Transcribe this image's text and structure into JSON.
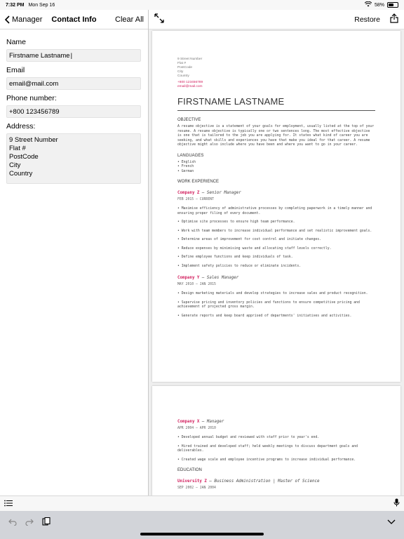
{
  "status": {
    "time": "7:32 PM",
    "date": "Mon Sep 16",
    "battery": "58%",
    "battery_level": 0.58
  },
  "nav": {
    "back_label": "Manager",
    "title": "Contact Info",
    "clear_label": "Clear All"
  },
  "form": {
    "name_label": "Name",
    "name_value": "Firstname Lastname",
    "email_label": "Email",
    "email_value": "email@mail.com",
    "phone_label": "Phone number:",
    "phone_value": "+800 123456789",
    "address_label": "Address:",
    "address_value": "9 Street Number\nFlat #\nPostCode\nCity\nCountry"
  },
  "toolbar": {
    "restore_label": "Restore"
  },
  "resume": {
    "address_lines": [
      "9 Street Number",
      "Flat #",
      "PostCode",
      "City",
      "Country"
    ],
    "phone": "+800 123456789",
    "email": "email@mail.com",
    "name": "FIRSTNAME LASTNAME",
    "objective_heading": "OBJECTIVE",
    "objective_text": "A resume objective is a statement of your goals for employment, usually listed at the top of your resume. A resume objective is typically one or two sentences long. The most effective objective is one that is tailored to the job you are applying for. It states what kind of career you are seeking, and what skills and experiences you have that make you ideal for that career. A resume objective might also include where you have been and where you want to go in your career.",
    "languages_heading": "LANGUAGES",
    "languages": [
      "• English",
      "• French",
      "• German"
    ],
    "work_heading": "WORK EXPERIENCE",
    "jobs_page1": [
      {
        "company": "Company Z",
        "role": " – Senior Manager",
        "dates": "FEB 2015 – CURRENT",
        "tasks": [
          "• Maximise efficiency of administrative processes by completing paperwork in a timely manner and ensuring proper filing of every document.",
          "• Optimise site processes to ensure high team performance.",
          "• Work with team members to increase individual performance and set realistic improvement goals.",
          "• Determine areas of improvement for cost control and initiate changes.",
          "• Reduce expenses by minimising waste and allocating staff levels correctly.",
          "• Define employee functions and keep individuals of task.",
          "• Implement safety policies to reduce or eliminate incidents."
        ]
      },
      {
        "company": "Company Y",
        "role": " – Sales Manager",
        "dates": "MAY 2010 – JAN 2015",
        "tasks": [
          "• Design marketing materials and develop strategies to increase sales and product recognition.",
          "• Supervise pricing and inventory policies and functions to ensure competitive pricing and achievement of projected gross margin.",
          "• Generate reports and keep board apprised of departments' initiatives and activities."
        ]
      }
    ],
    "job_page2": {
      "company": "Company X",
      "role": " – Manager",
      "dates": "APR 2004 – APR 2010",
      "tasks": [
        "• Developed annual budget and reviewed with staff prior to year's end.",
        "• Hired trained and developed staff; held weekly meetings to discuss department goals and deliverables.",
        "• Created wage scale and employee incentive programs to increase individual performance."
      ]
    },
    "education_heading": "EDUCATION",
    "education": {
      "school": "University Z",
      "degree": " – Business Administration | Master of Science",
      "dates": "SEP 2002 – JAN 2004"
    }
  }
}
